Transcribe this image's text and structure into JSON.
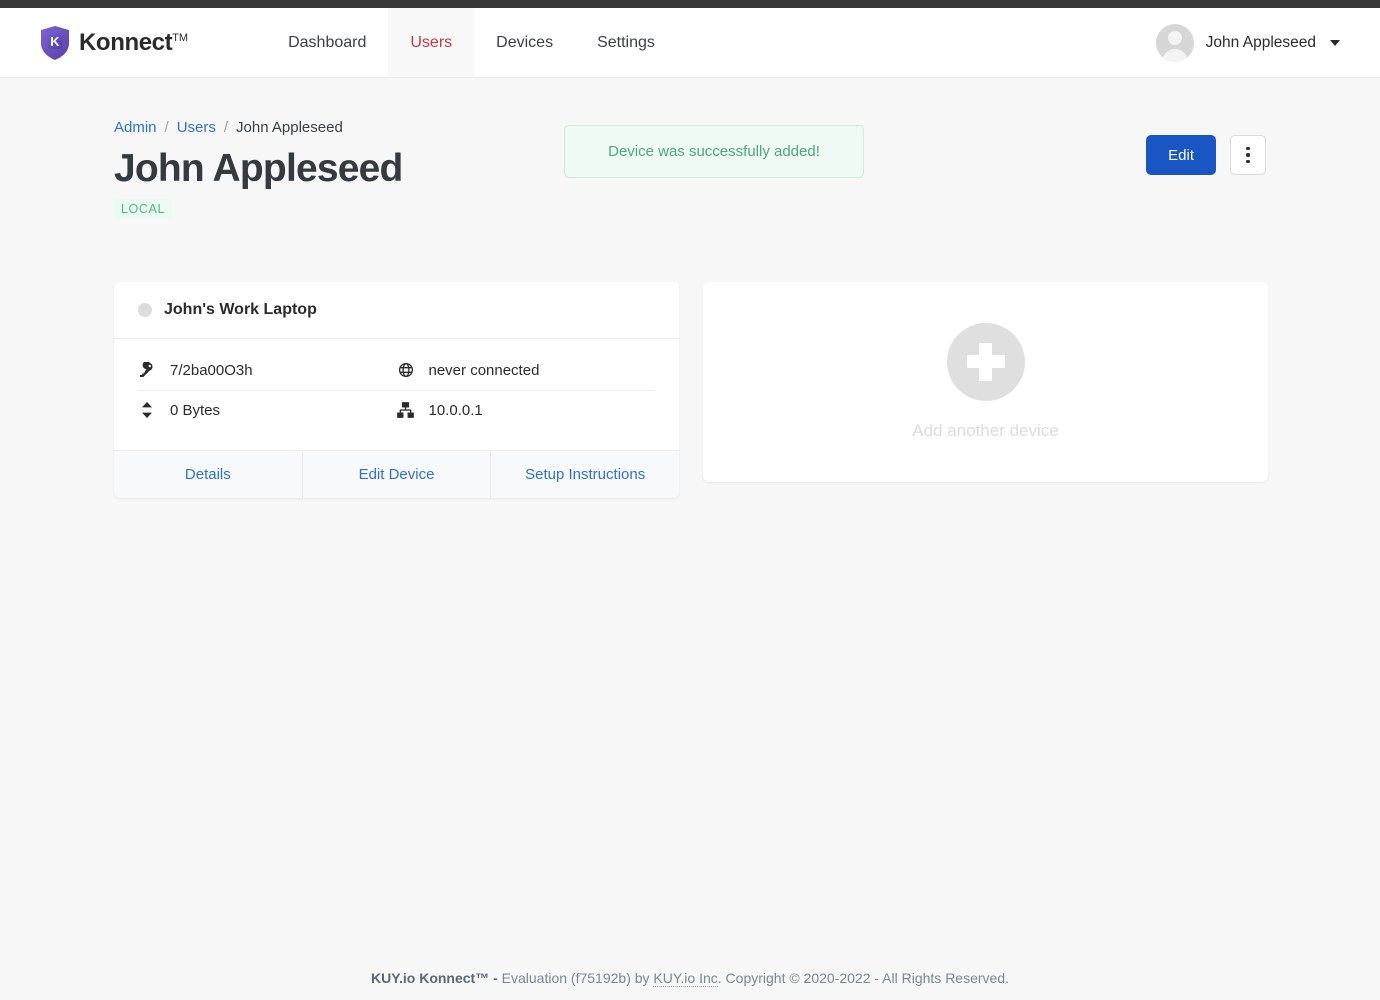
{
  "header": {
    "brand": "Konnect",
    "brand_tm": "TM",
    "logo_icon": "shield-k-logo",
    "nav": [
      {
        "label": "Dashboard",
        "active": false
      },
      {
        "label": "Users",
        "active": true
      },
      {
        "label": "Devices",
        "active": false
      },
      {
        "label": "Settings",
        "active": false
      }
    ],
    "user": {
      "name": "John Appleseed",
      "avatar_icon": "user-avatar-icon",
      "chevron_icon": "chevron-down-icon"
    }
  },
  "breadcrumb": {
    "admin": "Admin",
    "sep1": "/",
    "users": "Users",
    "sep2": "/",
    "current": "John Appleseed"
  },
  "page": {
    "title": "John Appleseed",
    "badge": "LOCAL"
  },
  "alert": {
    "message": "Device was successfully added!"
  },
  "actions": {
    "edit_label": "Edit",
    "more_icon": "kebab-menu-icon"
  },
  "device_card": {
    "status_icon": "status-dot-offline",
    "name": "John's Work Laptop",
    "info": [
      {
        "icon": "key-icon",
        "value": "7/2ba00O3h"
      },
      {
        "icon": "globe-icon",
        "value": "never connected"
      },
      {
        "icon": "transfer-icon",
        "value": "0 Bytes"
      },
      {
        "icon": "network-icon",
        "value": "10.0.0.1"
      }
    ],
    "links": [
      {
        "label": "Details"
      },
      {
        "label": "Edit Device"
      },
      {
        "label": "Setup Instructions"
      }
    ]
  },
  "add_card": {
    "icon": "plus-circle-icon",
    "label": "Add another device"
  },
  "footer": {
    "brand": "KUY.io Konnect™ -",
    "text_before": " Evaluation (f75192b) by ",
    "abbr": "KUY.io Inc",
    "text_after": ". Copyright © 2020-2022 - All Rights Reserved."
  },
  "colors": {
    "accent_blue": "#1a55c4",
    "link_blue": "#2f6fdd",
    "active_red": "#cf3441",
    "success_green": "#4aa97d",
    "badge_green": "#52b788",
    "page_bg": "#f7f7f7"
  }
}
